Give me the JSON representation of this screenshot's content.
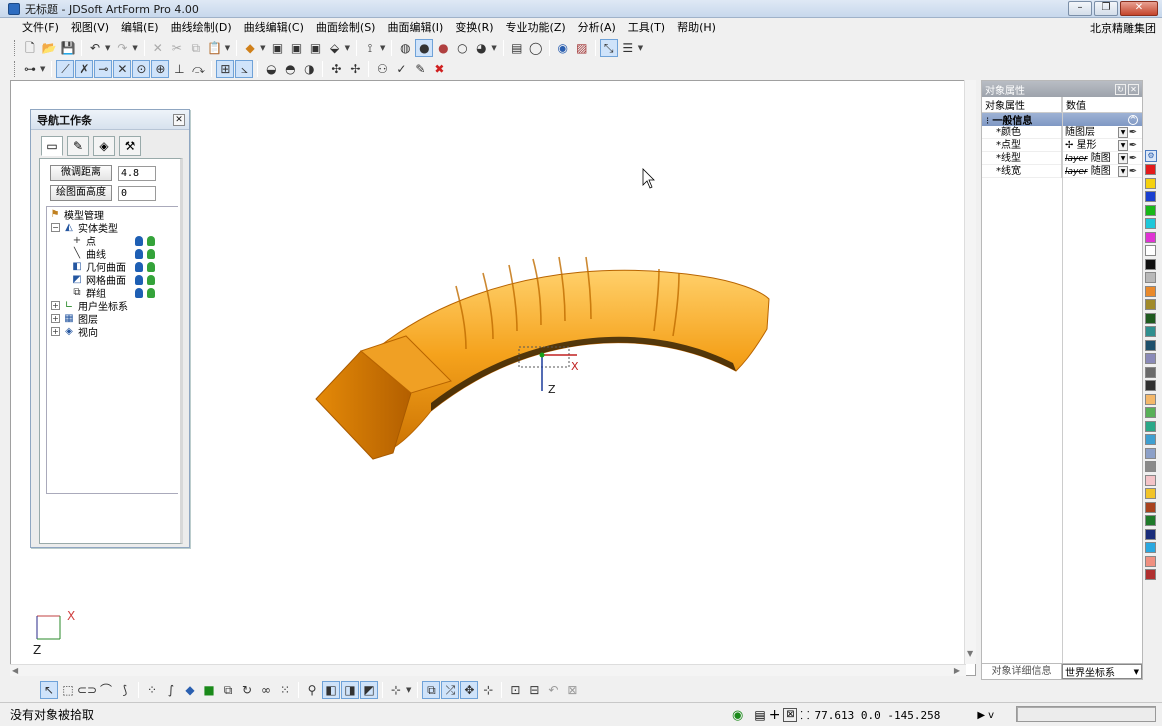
{
  "window": {
    "title": "无标题 - JDSoft ArtForm Pro 4.00",
    "company": "北京精雕集团"
  },
  "menu": [
    "文件(F)",
    "视图(V)",
    "编辑(E)",
    "曲线绘制(D)",
    "曲线编辑(C)",
    "曲面绘制(S)",
    "曲面编辑(I)",
    "变换(R)",
    "专业功能(Z)",
    "分析(A)",
    "工具(T)",
    "帮助(H)"
  ],
  "nav_panel": {
    "title": "导航工作条",
    "params": [
      {
        "label": "微调距离",
        "value": "4.8"
      },
      {
        "label": "绘图面高度",
        "value": "0"
      }
    ],
    "tree": {
      "root": "模型管理",
      "entity_group": "实体类型",
      "entities": [
        "点",
        "曲线",
        "几何曲面",
        "网格曲面",
        "群组"
      ],
      "others": [
        "用户坐标系",
        "图层",
        "视向"
      ]
    }
  },
  "viewport": {
    "axis_x": "X",
    "axis_z": "Z"
  },
  "properties": {
    "panel_title": "对象属性",
    "col_attr": "对象属性",
    "col_value": "数值",
    "group": "一般信息",
    "rows": [
      {
        "name": "*颜色",
        "value": "随图层"
      },
      {
        "name": "*点型",
        "value": "星形"
      },
      {
        "name": "*线型",
        "value_strike": "layer",
        "value": "随图"
      },
      {
        "name": "*线宽",
        "value_strike": "layer",
        "value": "随图"
      }
    ],
    "footer_tab": "对象详细信息",
    "coord_system": "世界坐标系"
  },
  "palette": [
    "#e41b1b",
    "#f5d10f",
    "#1a3fcf",
    "#18b818",
    "#1ec7d9",
    "#e033d4",
    "#ffffff",
    "#101010",
    "#b8b8b8",
    "#e9892a",
    "#a08a2a",
    "#1f5a1f",
    "#2f8f8f",
    "#1d4f6b",
    "#8a8ab8",
    "#6a6a6a",
    "#303030",
    "#f4b86a",
    "#58b058",
    "#2aa888",
    "#3f9fd0",
    "#8ca0c8",
    "#8a8a8a",
    "#f4c4c8",
    "#f2c428",
    "#a8421e",
    "#1f7a2a",
    "#1a2d7a",
    "#2aa8e0",
    "#f09080",
    "#b03030"
  ],
  "status": {
    "message": "没有对象被拾取",
    "coords": "77.613 0.0 -145.258",
    "mode": "v"
  }
}
